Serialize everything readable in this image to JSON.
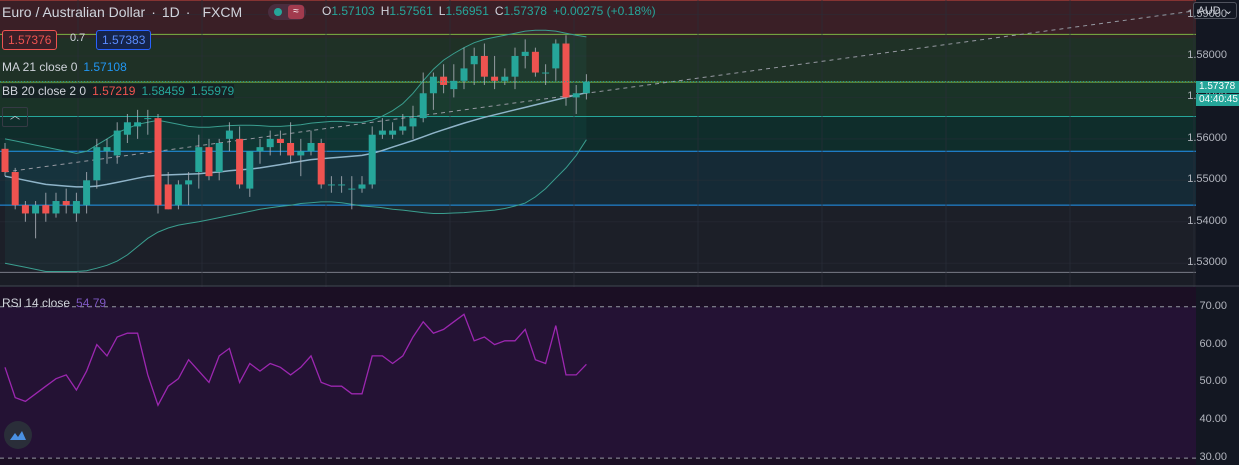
{
  "header": {
    "symbol": "Euro / Australian Dollar",
    "separator": "·",
    "timeframe": "1D",
    "exchange": "FXCM",
    "open_label": "O",
    "open": "1.57103",
    "high_label": "H",
    "high": "1.57561",
    "low_label": "L",
    "low": "1.56951",
    "close_label": "C",
    "close": "1.57378",
    "change": "+0.00275 (+0.18%)"
  },
  "trade": {
    "sell": "1.57376",
    "spread": "0.7",
    "buy": "1.57383"
  },
  "indicators": {
    "ma": {
      "label": "MA 21 close 0",
      "value": "1.57108"
    },
    "bb": {
      "label": "BB 20 close 2 0",
      "basis": "1.57219",
      "upper": "1.58459",
      "lower": "1.55979"
    },
    "rsi": {
      "label": "RSI 14 close",
      "value": "54.79"
    }
  },
  "currency": "AUD",
  "price_label": {
    "price": "1.57378",
    "countdown": "04:40:45"
  },
  "colors": {
    "up": "#26a69a",
    "down": "#ef5350",
    "ma": "#2196f3",
    "bb": "#3a9e8f",
    "rsi": "#9c27b0"
  },
  "chart_data": {
    "type": "candlestick",
    "title": "Euro / Australian Dollar",
    "ylim": [
      1.5245,
      1.5935
    ],
    "y_ticks": [
      "1.59000",
      "1.58000",
      "1.57000",
      "1.56000",
      "1.55000",
      "1.54000",
      "1.53000"
    ],
    "rsi_ylim": [
      28.2,
      75.2
    ],
    "rsi_ticks": [
      "70.00",
      "60.00",
      "50.00",
      "40.00",
      "30.00"
    ],
    "fib_levels": [
      1.5935,
      1.5852,
      1.5737,
      1.5654,
      1.557,
      1.544,
      1.5278
    ],
    "candles": [
      {
        "o": 1.5576,
        "h": 1.559,
        "l": 1.551,
        "c": 1.552
      },
      {
        "o": 1.552,
        "h": 1.553,
        "l": 1.543,
        "c": 1.544
      },
      {
        "o": 1.544,
        "h": 1.545,
        "l": 1.54,
        "c": 1.542
      },
      {
        "o": 1.542,
        "h": 1.545,
        "l": 1.536,
        "c": 1.544
      },
      {
        "o": 1.544,
        "h": 1.547,
        "l": 1.54,
        "c": 1.542
      },
      {
        "o": 1.542,
        "h": 1.547,
        "l": 1.541,
        "c": 1.545
      },
      {
        "o": 1.545,
        "h": 1.548,
        "l": 1.542,
        "c": 1.544
      },
      {
        "o": 1.542,
        "h": 1.547,
        "l": 1.54,
        "c": 1.545
      },
      {
        "o": 1.544,
        "h": 1.552,
        "l": 1.542,
        "c": 1.55
      },
      {
        "o": 1.55,
        "h": 1.56,
        "l": 1.548,
        "c": 1.558
      },
      {
        "o": 1.557,
        "h": 1.56,
        "l": 1.554,
        "c": 1.558
      },
      {
        "o": 1.556,
        "h": 1.564,
        "l": 1.554,
        "c": 1.562
      },
      {
        "o": 1.561,
        "h": 1.566,
        "l": 1.559,
        "c": 1.564
      },
      {
        "o": 1.563,
        "h": 1.567,
        "l": 1.56,
        "c": 1.564
      },
      {
        "o": 1.565,
        "h": 1.567,
        "l": 1.561,
        "c": 1.565
      },
      {
        "o": 1.565,
        "h": 1.566,
        "l": 1.542,
        "c": 1.544
      },
      {
        "o": 1.549,
        "h": 1.552,
        "l": 1.543,
        "c": 1.543
      },
      {
        "o": 1.544,
        "h": 1.55,
        "l": 1.543,
        "c": 1.549
      },
      {
        "o": 1.549,
        "h": 1.552,
        "l": 1.544,
        "c": 1.55
      },
      {
        "o": 1.552,
        "h": 1.561,
        "l": 1.548,
        "c": 1.558
      },
      {
        "o": 1.558,
        "h": 1.56,
        "l": 1.55,
        "c": 1.551
      },
      {
        "o": 1.552,
        "h": 1.56,
        "l": 1.55,
        "c": 1.559
      },
      {
        "o": 1.56,
        "h": 1.564,
        "l": 1.557,
        "c": 1.562
      },
      {
        "o": 1.56,
        "h": 1.563,
        "l": 1.548,
        "c": 1.549
      },
      {
        "o": 1.548,
        "h": 1.557,
        "l": 1.546,
        "c": 1.557
      },
      {
        "o": 1.557,
        "h": 1.56,
        "l": 1.554,
        "c": 1.558
      },
      {
        "o": 1.558,
        "h": 1.562,
        "l": 1.556,
        "c": 1.56
      },
      {
        "o": 1.56,
        "h": 1.562,
        "l": 1.556,
        "c": 1.559
      },
      {
        "o": 1.559,
        "h": 1.564,
        "l": 1.554,
        "c": 1.556
      },
      {
        "o": 1.556,
        "h": 1.56,
        "l": 1.551,
        "c": 1.557
      },
      {
        "o": 1.557,
        "h": 1.562,
        "l": 1.556,
        "c": 1.559
      },
      {
        "o": 1.559,
        "h": 1.56,
        "l": 1.548,
        "c": 1.549
      },
      {
        "o": 1.549,
        "h": 1.551,
        "l": 1.547,
        "c": 1.549
      },
      {
        "o": 1.549,
        "h": 1.551,
        "l": 1.547,
        "c": 1.549
      },
      {
        "o": 1.548,
        "h": 1.551,
        "l": 1.543,
        "c": 1.548
      },
      {
        "o": 1.548,
        "h": 1.551,
        "l": 1.547,
        "c": 1.549
      },
      {
        "o": 1.549,
        "h": 1.563,
        "l": 1.548,
        "c": 1.561
      },
      {
        "o": 1.561,
        "h": 1.565,
        "l": 1.56,
        "c": 1.562
      },
      {
        "o": 1.561,
        "h": 1.564,
        "l": 1.56,
        "c": 1.562
      },
      {
        "o": 1.562,
        "h": 1.566,
        "l": 1.561,
        "c": 1.563
      },
      {
        "o": 1.563,
        "h": 1.568,
        "l": 1.56,
        "c": 1.565
      },
      {
        "o": 1.565,
        "h": 1.576,
        "l": 1.564,
        "c": 1.571
      },
      {
        "o": 1.571,
        "h": 1.576,
        "l": 1.567,
        "c": 1.575
      },
      {
        "o": 1.575,
        "h": 1.578,
        "l": 1.571,
        "c": 1.573
      },
      {
        "o": 1.572,
        "h": 1.578,
        "l": 1.57,
        "c": 1.574
      },
      {
        "o": 1.574,
        "h": 1.582,
        "l": 1.572,
        "c": 1.577
      },
      {
        "o": 1.578,
        "h": 1.582,
        "l": 1.573,
        "c": 1.58
      },
      {
        "o": 1.58,
        "h": 1.583,
        "l": 1.573,
        "c": 1.575
      },
      {
        "o": 1.575,
        "h": 1.58,
        "l": 1.572,
        "c": 1.574
      },
      {
        "o": 1.574,
        "h": 1.577,
        "l": 1.573,
        "c": 1.575
      },
      {
        "o": 1.575,
        "h": 1.582,
        "l": 1.572,
        "c": 1.58
      },
      {
        "o": 1.58,
        "h": 1.584,
        "l": 1.577,
        "c": 1.581
      },
      {
        "o": 1.581,
        "h": 1.582,
        "l": 1.575,
        "c": 1.576
      },
      {
        "o": 1.576,
        "h": 1.578,
        "l": 1.573,
        "c": 1.576
      },
      {
        "o": 1.577,
        "h": 1.584,
        "l": 1.574,
        "c": 1.583
      },
      {
        "o": 1.583,
        "h": 1.585,
        "l": 1.568,
        "c": 1.57
      },
      {
        "o": 1.57,
        "h": 1.573,
        "l": 1.566,
        "c": 1.571
      },
      {
        "o": 1.571,
        "h": 1.5756,
        "l": 1.5695,
        "c": 1.5738
      }
    ],
    "ma": [
      1.551,
      1.5505,
      1.55,
      1.5495,
      1.549,
      1.5488,
      1.5486,
      1.5484,
      1.5484,
      1.5486,
      1.549,
      1.5495,
      1.55,
      1.5505,
      1.551,
      1.5512,
      1.5513,
      1.5514,
      1.5515,
      1.5516,
      1.5518,
      1.552,
      1.5523,
      1.5525,
      1.5527,
      1.553,
      1.5534,
      1.5538,
      1.5542,
      1.5546,
      1.555,
      1.5552,
      1.5554,
      1.5556,
      1.5558,
      1.556,
      1.5565,
      1.5572,
      1.558,
      1.5588,
      1.5596,
      1.5605,
      1.5614,
      1.5622,
      1.563,
      1.5638,
      1.5645,
      1.5652,
      1.5658,
      1.5664,
      1.567,
      1.5676,
      1.5682,
      1.5688,
      1.5694,
      1.57,
      1.5706,
      1.5711
    ],
    "bb_upper": [
      1.56,
      1.5595,
      1.559,
      1.5585,
      1.558,
      1.5575,
      1.557,
      1.5565,
      1.557,
      1.5585,
      1.56,
      1.5615,
      1.5625,
      1.5635,
      1.564,
      1.5645,
      1.564,
      1.5635,
      1.563,
      1.5628,
      1.5628,
      1.563,
      1.5632,
      1.5633,
      1.5633,
      1.5632,
      1.563,
      1.563,
      1.5632,
      1.5634,
      1.5638,
      1.564,
      1.5642,
      1.5642,
      1.564,
      1.564,
      1.5645,
      1.5655,
      1.5668,
      1.5685,
      1.571,
      1.574,
      1.5768,
      1.579,
      1.5806,
      1.582,
      1.5832,
      1.584,
      1.5845,
      1.585,
      1.5855,
      1.586,
      1.5862,
      1.5862,
      1.586,
      1.5855,
      1.585,
      1.5846
    ],
    "bb_lower": [
      1.53,
      1.5295,
      1.529,
      1.5285,
      1.528,
      1.528,
      1.528,
      1.528,
      1.5282,
      1.5288,
      1.5295,
      1.5305,
      1.532,
      1.534,
      1.536,
      1.5375,
      1.5385,
      1.5392,
      1.5396,
      1.54,
      1.5405,
      1.541,
      1.5415,
      1.542,
      1.5425,
      1.543,
      1.5434,
      1.5437,
      1.544,
      1.5444,
      1.5446,
      1.5448,
      1.5448,
      1.5446,
      1.5442,
      1.5438,
      1.5436,
      1.5434,
      1.543,
      1.5428,
      1.5425,
      1.5422,
      1.542,
      1.542,
      1.5421,
      1.5422,
      1.5424,
      1.5426,
      1.5428,
      1.5432,
      1.5438,
      1.5445,
      1.546,
      1.548,
      1.5505,
      1.553,
      1.556,
      1.5598
    ],
    "rsi": [
      54,
      46,
      45,
      47,
      49,
      51,
      52,
      48,
      53,
      60,
      57,
      62,
      63,
      63,
      52,
      44,
      49,
      51,
      56,
      53,
      50,
      57,
      59,
      50,
      55,
      53,
      55,
      54,
      52,
      54,
      57,
      50,
      49,
      49,
      47,
      47,
      57,
      57,
      55,
      57,
      62,
      66,
      63,
      64,
      66,
      68,
      61,
      62,
      60,
      61,
      61,
      64,
      56,
      55,
      65,
      52,
      52,
      54.79
    ],
    "trendline": {
      "start": {
        "i": 0,
        "v": 1.552
      },
      "end": {
        "i": 57,
        "v": 1.571
      }
    }
  }
}
